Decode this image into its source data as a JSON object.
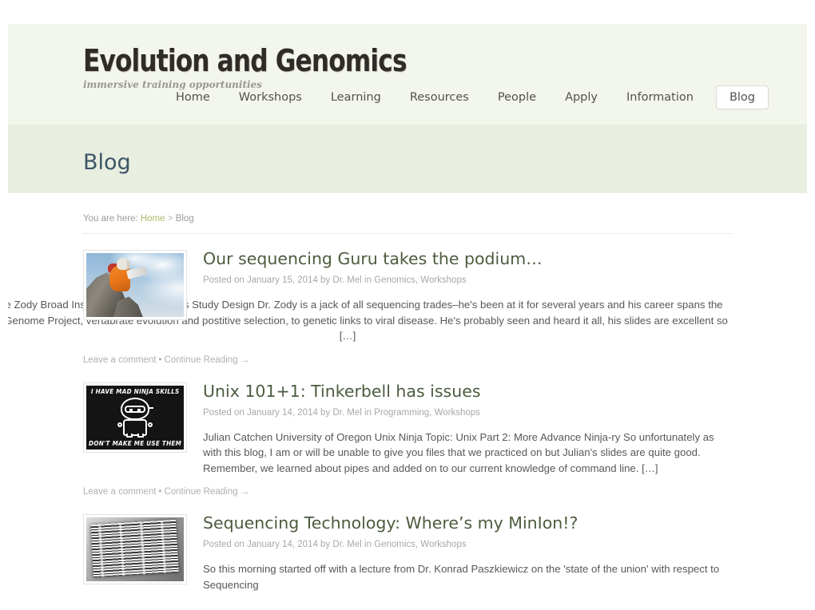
{
  "site": {
    "title": "Evolution and Genomics",
    "tagline": "immersive training opportunities"
  },
  "nav": {
    "items": [
      {
        "label": "Home",
        "current": false
      },
      {
        "label": "Workshops",
        "current": false
      },
      {
        "label": "Learning",
        "current": false
      },
      {
        "label": "Resources",
        "current": false
      },
      {
        "label": "People",
        "current": false
      },
      {
        "label": "Apply",
        "current": false
      },
      {
        "label": "Information",
        "current": false
      },
      {
        "label": "Blog",
        "current": true
      }
    ]
  },
  "page": {
    "title": "Blog"
  },
  "breadcrumb": {
    "prefix": "You are here:",
    "home_label": "Home",
    "separator": ">",
    "current_label": "Blog"
  },
  "posts": [
    {
      "title": "Our sequencing Guru takes the podium…",
      "meta_prefix": "Posted on",
      "date": "January 15, 2014",
      "by_label": "by",
      "author": "Dr. Mel",
      "in_label": "in",
      "categories": "Genomics, Workshops",
      "meta_full": "Posted on January 15, 2014 by Dr. Mel in Genomics, Workshops",
      "excerpt": "Dr. Mike Zody Broad Institute Topic: Genomics Study Design Dr. Zody is a jack of all sequencing trades–he's been at it for several years and his career spans the Human Genome Project, vertabrate evolution and postitive selection, to genetic links to viral disease. He's probably seen and heard it all, his slides are excellent so […]",
      "comment_label": "Leave a comment",
      "separator": "•",
      "continue_label": "Continue Reading →",
      "thumb": "guru-on-mountain-photo"
    },
    {
      "title": "Unix 101+1: Tinkerbell has issues",
      "meta_prefix": "Posted on",
      "date": "January 14, 2014",
      "by_label": "by",
      "author": "Dr. Mel",
      "in_label": "in",
      "categories": "Programming, Workshops",
      "meta_full": "Posted on January 14, 2014 by Dr. Mel in Programming, Workshops",
      "excerpt": "Julian Catchen University of Oregon Unix Ninja Topic: Unix Part 2: More Advance Ninja-ry So unfortunately as with this blog, I am or will be unable to give you files that we practiced on but Julian's slides are quite good. Remember, we learned about pipes and added on to our current knowledge of command line. […]",
      "comment_label": "Leave a comment",
      "separator": "•",
      "continue_label": "Continue Reading →",
      "thumb": "ninja-meme-image",
      "thumb_text_top": "I HAVE MAD NINJA SKILLS",
      "thumb_text_bottom": "DON'T MAKE ME USE THEM"
    },
    {
      "title": "Sequencing Technology: Where’s my MinIon!?",
      "meta_prefix": "Posted on",
      "date": "January 14, 2014",
      "by_label": "by",
      "author": "Dr. Mel",
      "in_label": "in",
      "categories": "Genomics, Workshops",
      "meta_full": "Posted on January 14, 2014 by Dr. Mel in Genomics, Workshops",
      "excerpt": "So this morning started off with a lecture from Dr. Konrad Paszkiewicz on the 'state of the union' with respect to Sequencing",
      "thumb": "sequencing-gel-image"
    }
  ],
  "colors": {
    "header_bg": "#f3f6ed",
    "title_band_bg": "#e8eee0",
    "page_title": "#3d5567",
    "post_title": "#4c5c3f",
    "link_green": "#a8bd6a",
    "body_text": "#58585a",
    "muted": "#a8a8a8"
  }
}
